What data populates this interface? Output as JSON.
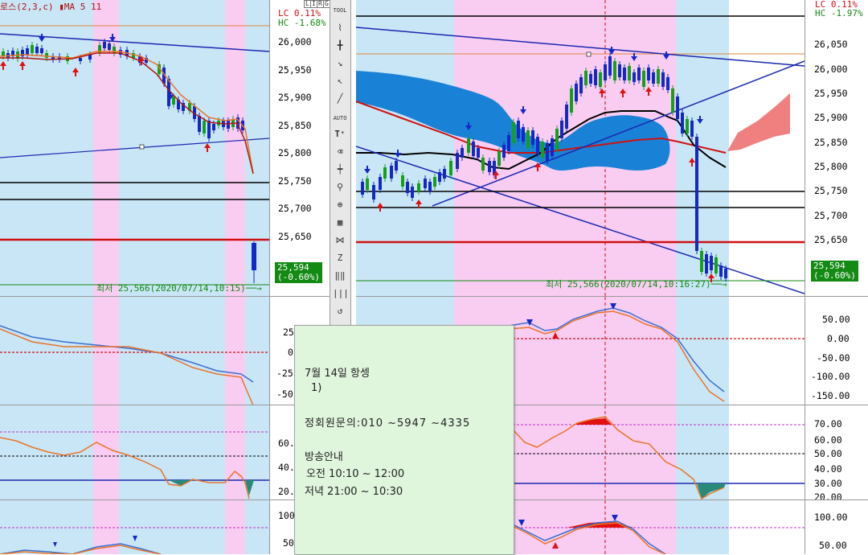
{
  "left_chart": {
    "legend": "로스(2,3,c) ▮MA 5 11",
    "lc": "LC  0.11%",
    "hc": "HC -1.68%",
    "price_ticks": [
      "26,000",
      "25,950",
      "25,900",
      "25,850",
      "25,800",
      "25,750",
      "25,700",
      "25,650"
    ],
    "current_price": "25,594",
    "current_change": "(-0.60%)",
    "low_note": "최저 25,566(2020/07/14,10:15)──→",
    "osc1_ticks": [
      "25",
      "0",
      "-25",
      "-50"
    ],
    "osc2_ticks": [
      "60.0",
      "40.0",
      "20.0"
    ],
    "osc3_ticks": [
      "100",
      "50"
    ]
  },
  "right_chart": {
    "lc": "LC  0.11%",
    "hc": "HC -1.97%",
    "price_ticks": [
      "26,050",
      "26,000",
      "25,950",
      "25,900",
      "25,850",
      "25,800",
      "25,750",
      "25,700",
      "25,650"
    ],
    "current_price": "25,594",
    "current_change": "(-0.60%)",
    "low_note": "최저 25,566(2020/07/14,10:16:27)──→",
    "osc1_ticks": [
      "50.00",
      "0.00",
      "-50.00",
      "-100.00",
      "-150.00"
    ],
    "osc2_ticks": [
      "70.00",
      "60.00",
      "50.00",
      "40.00",
      "30.00",
      "20.00"
    ],
    "osc3_ticks": [
      "100.00",
      "50.00"
    ]
  },
  "toolbar": {
    "label_tool": "TOOL",
    "label_auto": "AUTO",
    "panel_labels": [
      "L",
      "I",
      "R",
      "G"
    ]
  },
  "popup": {
    "title": "7월 14일 항셍",
    "item": "1)",
    "contact": "정회원문의:010 ~5947 ~4335",
    "broadcast_heading": "방송안내",
    "morning": "오전 10:10 ~ 12:00",
    "evening": "저녁 21:00 ~ 10:30"
  },
  "colors": {
    "session_blue": "#c9e6f6",
    "session_pink": "#f9cdf2",
    "up_candle": "#1428c8",
    "down_candle": "#16a016",
    "ma_red": "#cc1111",
    "ma_orange": "#e8742a",
    "accent_green": "#138a13",
    "cloud_blue": "#1a82d6"
  }
}
